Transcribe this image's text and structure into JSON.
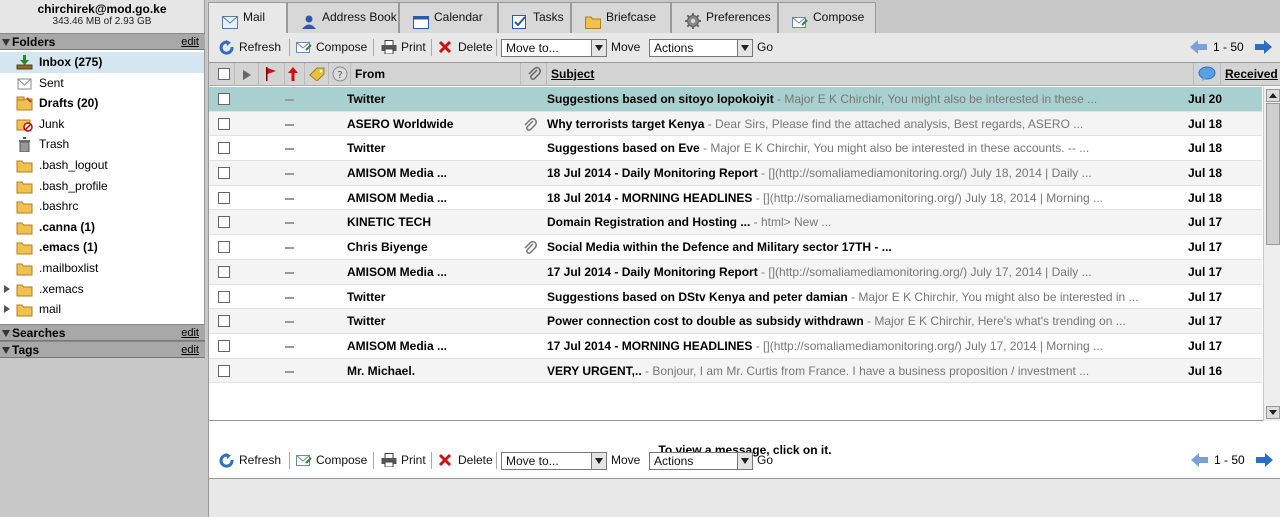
{
  "account": {
    "email": "chirchirek@mod.go.ke",
    "quota": "343.46 MB of 2.93 GB"
  },
  "sidebar": {
    "folders_title": "Folders",
    "searches_title": "Searches",
    "tags_title": "Tags",
    "edit_label": "edit",
    "folders": [
      {
        "label": "Inbox (275)",
        "bold": true,
        "icon": "inbox-icon"
      },
      {
        "label": "Sent",
        "bold": false,
        "icon": "sent-icon"
      },
      {
        "label": "Drafts (20)",
        "bold": true,
        "icon": "drafts-icon"
      },
      {
        "label": "Junk",
        "bold": false,
        "icon": "junk-icon"
      },
      {
        "label": "Trash",
        "bold": false,
        "icon": "trash-icon"
      },
      {
        "label": ".bash_logout",
        "bold": false,
        "icon": "folder-icon"
      },
      {
        "label": ".bash_profile",
        "bold": false,
        "icon": "folder-icon"
      },
      {
        "label": ".bashrc",
        "bold": false,
        "icon": "folder-icon"
      },
      {
        "label": ".canna (1)",
        "bold": true,
        "icon": "folder-icon"
      },
      {
        "label": ".emacs (1)",
        "bold": true,
        "icon": "folder-icon"
      },
      {
        "label": ".mailboxlist",
        "bold": false,
        "icon": "folder-icon"
      },
      {
        "label": ".xemacs",
        "bold": false,
        "icon": "folder-icon",
        "expandable": true
      },
      {
        "label": "mail",
        "bold": false,
        "icon": "folder-icon",
        "expandable": true
      }
    ]
  },
  "tabs": [
    {
      "label": "Mail",
      "icon": "mail-icon",
      "active": true
    },
    {
      "label": "Address Book",
      "icon": "address-book-icon"
    },
    {
      "label": "Calendar",
      "icon": "calendar-icon"
    },
    {
      "label": "Tasks",
      "icon": "tasks-icon"
    },
    {
      "label": "Briefcase",
      "icon": "briefcase-icon"
    },
    {
      "label": "Preferences",
      "icon": "gear-icon"
    },
    {
      "label": "Compose",
      "icon": "compose-icon"
    }
  ],
  "toolbar": {
    "refresh": "Refresh",
    "compose": "Compose",
    "print": "Print",
    "delete": "Delete",
    "move_to": "Move to...",
    "move": "Move",
    "actions": "Actions",
    "go": "Go",
    "page_range": "1 - 50"
  },
  "columns": {
    "from": "From",
    "subject": "Subject",
    "received": "Received"
  },
  "messages": [
    {
      "from": "Twitter",
      "subject": "Suggestions based on sitoyo lopokoiyit",
      "fragment": " - Major E K Chirchir, You might also be interested in these ...",
      "date": "Jul 20",
      "attachment": false,
      "selected": true
    },
    {
      "from": "ASERO Worldwide",
      "subject": "Why terrorists target Kenya",
      "fragment": " - Dear Sirs, Please find the attached analysis, Best regards, ASERO ...",
      "date": "Jul 18",
      "attachment": true
    },
    {
      "from": "Twitter",
      "subject": "Suggestions based on Eve",
      "fragment": " - Major E K Chirchir, You might also be interested in these accounts. -- ...",
      "date": "Jul 18",
      "attachment": false
    },
    {
      "from": "AMISOM Media ...",
      "subject": "18 Jul 2014 - Daily Monitoring Report",
      "fragment": " - [](http://somaliamediamonitoring.org/) July 18, 2014 | Daily ...",
      "date": "Jul 18",
      "attachment": false
    },
    {
      "from": "AMISOM Media ...",
      "subject": "18 Jul 2014 - MORNING HEADLINES",
      "fragment": " - [](http://somaliamediamonitoring.org/) July 18, 2014 | Morning ...",
      "date": "Jul 18",
      "attachment": false
    },
    {
      "from": "KINETIC TECH",
      "subject": "Domain Registration and Hosting ...",
      "fragment": " - html> New ...",
      "date": "Jul 17",
      "attachment": false
    },
    {
      "from": "Chris Biyenge",
      "subject": "Social Media within the Defence and Military sector 17TH - ...",
      "fragment": "",
      "date": "Jul 17",
      "attachment": true
    },
    {
      "from": "AMISOM Media ...",
      "subject": "17 Jul 2014 - Daily Monitoring Report",
      "fragment": " - [](http://somaliamediamonitoring.org/) July 17, 2014 | Daily ...",
      "date": "Jul 17",
      "attachment": false
    },
    {
      "from": "Twitter",
      "subject": "Suggestions based on DStv Kenya and peter damian",
      "fragment": " - Major E K Chirchir, You might also be interested in ...",
      "date": "Jul 17",
      "attachment": false
    },
    {
      "from": "Twitter",
      "subject": "Power connection cost to double as subsidy withdrawn",
      "fragment": " - Major E K Chirchir, Here's what's trending on ...",
      "date": "Jul 17",
      "attachment": false
    },
    {
      "from": "AMISOM Media ...",
      "subject": "17 Jul 2014 - MORNING HEADLINES",
      "fragment": " - [](http://somaliamediamonitoring.org/) July 17, 2014 | Morning ...",
      "date": "Jul 17",
      "attachment": false
    },
    {
      "from": "Mr. Michael.",
      "subject": "VERY URGENT,..",
      "fragment": " - Bonjour, I am Mr. Curtis from France. I have a business proposition / investment ...",
      "date": "Jul 16",
      "attachment": false
    }
  ],
  "preview": {
    "message": "To view a message, click on it."
  },
  "colors": {
    "selected_row": "#a8d0d0",
    "accent_blue": "#2a6fc4",
    "flag_red": "#cc1111"
  }
}
